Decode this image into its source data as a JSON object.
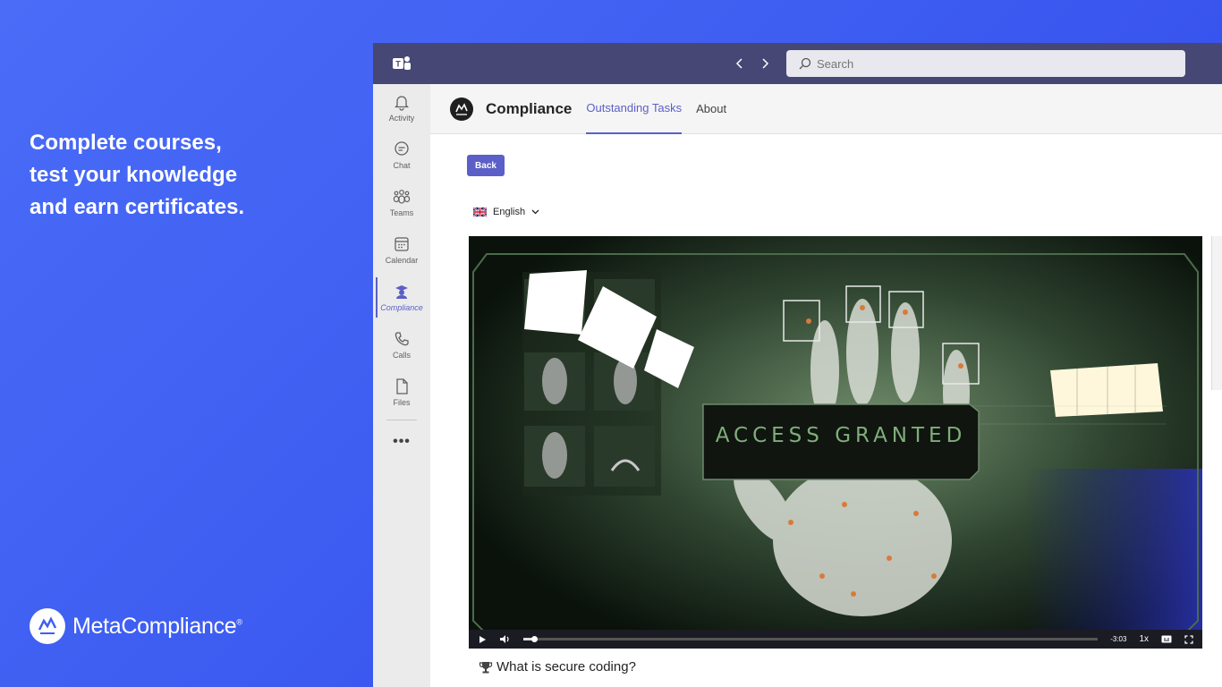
{
  "promo": {
    "line1": "Complete courses,",
    "line2": "test your knowledge",
    "line3": "and earn certificates."
  },
  "brand": {
    "name": "MetaCompliance",
    "mark": "®"
  },
  "teams": {
    "search_placeholder": "Search",
    "rail": [
      {
        "label": "Activity",
        "icon": "bell-icon"
      },
      {
        "label": "Chat",
        "icon": "chat-icon"
      },
      {
        "label": "Teams",
        "icon": "teams-icon"
      },
      {
        "label": "Calendar",
        "icon": "calendar-icon"
      },
      {
        "label": "Compliance",
        "icon": "compliance-icon"
      },
      {
        "label": "Calls",
        "icon": "phone-icon"
      },
      {
        "label": "Files",
        "icon": "file-icon"
      }
    ],
    "more": "•••"
  },
  "app": {
    "title": "Compliance",
    "tabs": [
      "Outstanding Tasks",
      "About"
    ],
    "active_tab": "Outstanding Tasks",
    "back_label": "Back",
    "language": "English",
    "video_overlay_text": "ACCESS GRANTED",
    "time_remaining": "-3:03",
    "speed": "1x",
    "progress": 0.018,
    "question": "What is secure coding?"
  },
  "colors": {
    "teams_bar": "#464775",
    "accent": "#5b5fc7",
    "background": "#3f5ff2"
  }
}
